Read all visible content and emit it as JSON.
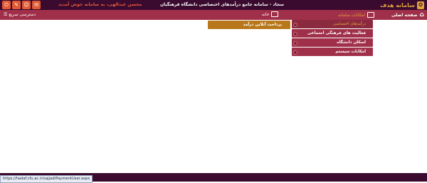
{
  "header": {
    "logo_text": "سامانه هدف",
    "logo_icon": "seal-icon",
    "system_title": "سجاد - سامانه جامع درآمدهای اختصاصی دانشگاه فرهنگیان",
    "welcome": "محسن عبدالهی، به سامانه خوش آمدید",
    "icon_buttons": [
      {
        "name": "inbox-icon",
        "glyph": "✉"
      },
      {
        "name": "user-icon",
        "glyph": "👤"
      },
      {
        "name": "user-edit-icon",
        "glyph": "✎"
      },
      {
        "name": "power-icon",
        "glyph": "⏻"
      }
    ]
  },
  "navbar": {
    "home_label": "صفحه اصلی",
    "system_features_label": "امکانات سامانه",
    "home_tab_label": "خانه",
    "quick_access_label": "دسترسی سریع"
  },
  "dropdown": {
    "items": [
      {
        "label": "درآمدهای اختصاصی",
        "active": true
      },
      {
        "label": "فعالیت های فرهنگی اجتماعی",
        "active": false
      },
      {
        "label": "اسکان دانشگاه",
        "active": false
      },
      {
        "label": "امکانات سیستم",
        "active": false
      }
    ],
    "submenu_label": "پرداخت آنلاین درآمد"
  },
  "status": {
    "url": "https://hadaf.cfu.ac.ir/sajjad/PaymentUser.aspx"
  },
  "colors": {
    "topbar": "#3a0a2f",
    "navbar": "#a0304a",
    "accent": "#e0a43a",
    "submenu": "#b8771a",
    "welcome": "#e65a3b"
  }
}
